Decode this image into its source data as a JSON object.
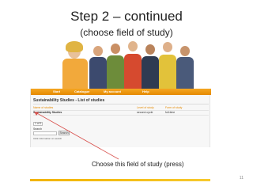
{
  "slide": {
    "title": "Step 2 – continued",
    "subtitle": "(choose field of study)",
    "caption": "Choose this field of study (press)",
    "page_number": "11"
  },
  "site": {
    "nav": [
      {
        "label": "Start"
      },
      {
        "label": "Catalogue"
      },
      {
        "label": "My account"
      },
      {
        "label": "Help"
      }
    ],
    "heading": "Sustainability Studies - List of studies",
    "table": {
      "headers": [
        "Name of studies",
        "Level of study",
        "Form of study"
      ],
      "rows": [
        [
          "Sustainability Studies",
          "second-cycle",
          "full-time"
        ]
      ]
    },
    "pager_value": "1 of 1",
    "search_label": "Search",
    "search_button": "Search",
    "info_link": "Click information on search"
  },
  "colors": {
    "nav_orange": "#f5a623",
    "footer_yellow": "#f2b400",
    "arrow_red": "#d9534f"
  }
}
